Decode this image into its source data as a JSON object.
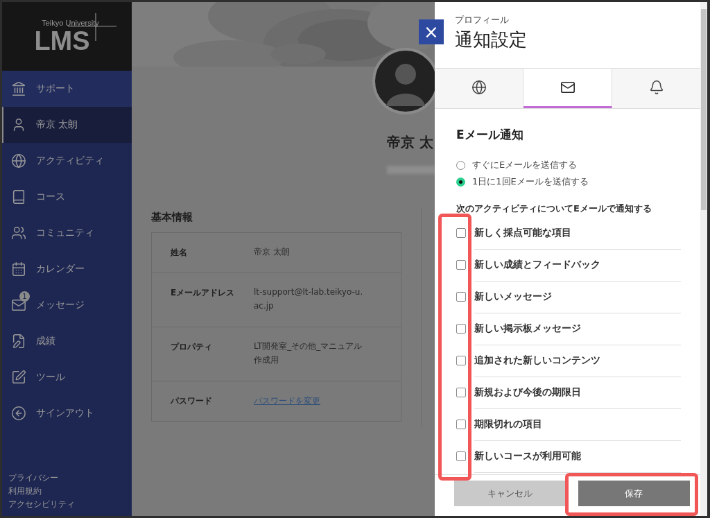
{
  "logo": {
    "small": "Teikyo University",
    "large": "LMS"
  },
  "nav": [
    {
      "label": "サポート",
      "selected": false
    },
    {
      "label": "帝京 太朗",
      "selected": true
    },
    {
      "label": "アクティビティ",
      "selected": false
    },
    {
      "label": "コース",
      "selected": false
    },
    {
      "label": "コミュニティ",
      "selected": false
    },
    {
      "label": "カレンダー",
      "selected": false
    },
    {
      "label": "メッセージ",
      "selected": false,
      "badge": "1"
    },
    {
      "label": "成績",
      "selected": false
    },
    {
      "label": "ツール",
      "selected": false
    },
    {
      "label": "サインアウト",
      "selected": false
    }
  ],
  "footer_links": [
    "プライバシー",
    "利用規約",
    "アクセシビリティ"
  ],
  "profile": {
    "name": "帝京 太"
  },
  "basic_info": {
    "title": "基本情報",
    "rows": [
      {
        "label": "姓名",
        "value": "帝京 太朗",
        "kind": "text"
      },
      {
        "label": "Eメールアドレス",
        "value": "lt-support@lt-lab.teikyo-u.ac.jp",
        "kind": "text"
      },
      {
        "label": "プロパティ",
        "value": "LT開発室_その他_マニュアル作成用",
        "kind": "text"
      },
      {
        "label": "パスワード",
        "value": "パスワードを変更",
        "kind": "link"
      }
    ]
  },
  "panel": {
    "close": "×",
    "subtitle": "プロフィール",
    "title": "通知設定",
    "tabs": [
      {
        "selected": false
      },
      {
        "selected": true
      },
      {
        "selected": false
      }
    ],
    "section_title": "Eメール通知",
    "radios": [
      {
        "label": "すぐにEメールを送信する",
        "selected": false
      },
      {
        "label": "1日に1回Eメールを送信する",
        "selected": true
      }
    ],
    "checkbox_heading": "次のアクティビティについてEメールで通知する",
    "checkboxes": [
      {
        "label": "新しく採点可能な項目",
        "checked": false
      },
      {
        "label": "新しい成績とフィードバック",
        "checked": false
      },
      {
        "label": "新しいメッセージ",
        "checked": false
      },
      {
        "label": "新しい掲示板メッセージ",
        "checked": false
      },
      {
        "label": "追加された新しいコンテンツ",
        "checked": false
      },
      {
        "label": "新規および今後の期限日",
        "checked": false
      },
      {
        "label": "期限切れの項目",
        "checked": false
      },
      {
        "label": "新しいコースが利用可能",
        "checked": false
      }
    ],
    "buttons": [
      {
        "label": "キャンセル",
        "kind": "secondary"
      },
      {
        "label": "保存",
        "kind": "primary"
      }
    ]
  }
}
